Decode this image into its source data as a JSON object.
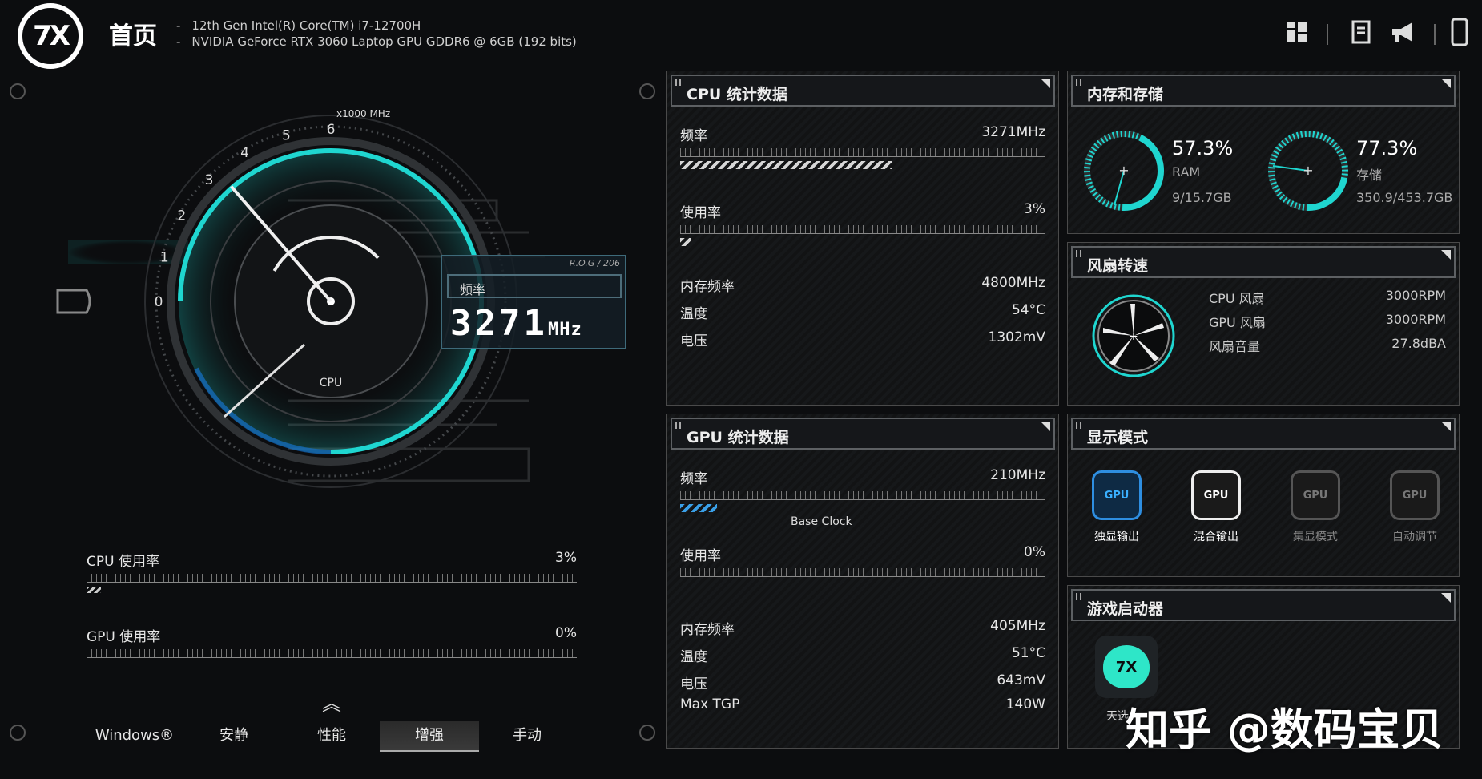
{
  "header": {
    "logo_text": "7X",
    "title": "首页",
    "cpu_info": "12th Gen Intel(R) Core(TM) i7-12700H",
    "gpu_info": "NVIDIA GeForce RTX 3060 Laptop GPU GDDR6 @ 6GB (192 bits)",
    "icons": [
      "layout-icon",
      "notes-icon",
      "announcement-icon",
      "phone-icon"
    ]
  },
  "gauge": {
    "scale_unit": "x1000 MHz",
    "ticks": [
      "0",
      "1",
      "2",
      "3",
      "4",
      "5",
      "6"
    ],
    "center_label": "CPU",
    "box_tag": "R.O.G / 206",
    "box_label": "频率",
    "box_value": "3271",
    "box_unit": "MHz",
    "level_ghz": 3.271
  },
  "usage": {
    "cpu": {
      "label": "CPU 使用率",
      "value": "3%",
      "level": 0.03
    },
    "gpu": {
      "label": "GPU 使用率",
      "value": "0%",
      "level": 0.0
    }
  },
  "modes": [
    {
      "label": "Windows®",
      "active": false
    },
    {
      "label": "安静",
      "active": false
    },
    {
      "label": "性能",
      "active": false
    },
    {
      "label": "增强",
      "active": true
    },
    {
      "label": "手动",
      "active": false
    }
  ],
  "cpu_panel": {
    "title": "CPU 统计数据",
    "freq_label": "频率",
    "freq_value": "3271MHz",
    "freq_level": 0.58,
    "usage_label": "使用率",
    "usage_value": "3%",
    "usage_level": 0.03,
    "mem_label": "内存频率",
    "mem_value": "4800MHz",
    "temp_label": "温度",
    "temp_value": "54°C",
    "volt_label": "电压",
    "volt_value": "1302mV"
  },
  "gpu_panel": {
    "title": "GPU 统计数据",
    "freq_label": "频率",
    "freq_value": "210MHz",
    "freq_level": 0.1,
    "base_clock_label": "Base Clock",
    "usage_label": "使用率",
    "usage_value": "0%",
    "mem_label": "内存频率",
    "mem_value": "405MHz",
    "temp_label": "温度",
    "temp_value": "51°C",
    "volt_label": "电压",
    "volt_value": "643mV",
    "tgp_label": "Max TGP",
    "tgp_value": "140W"
  },
  "memory_panel": {
    "title": "内存和存储",
    "ram": {
      "percent": "57.3%",
      "label": "RAM",
      "detail": "9/15.7GB",
      "level": 0.573
    },
    "storage": {
      "percent": "77.3%",
      "label": "存储",
      "detail": "350.9/453.7GB",
      "level": 0.773
    }
  },
  "fan_panel": {
    "title": "风扇转速",
    "cpu_fan_label": "CPU 风扇",
    "cpu_fan_value": "3000RPM",
    "gpu_fan_label": "GPU 风扇",
    "gpu_fan_value": "3000RPM",
    "noise_label": "风扇音量",
    "noise_value": "27.8dBA"
  },
  "display_panel": {
    "title": "显示模式",
    "modes": [
      {
        "label": "独显输出",
        "icon": "GPU"
      },
      {
        "label": "混合输出",
        "icon": "GPU"
      },
      {
        "label": "集显模式",
        "icon": "GPU"
      },
      {
        "label": "自动调节",
        "icon": "GPU"
      }
    ]
  },
  "game_panel": {
    "title": "游戏启动器",
    "app_label": "天选",
    "app_icon_text": "7X"
  },
  "watermark": "知乎 @数码宝贝",
  "colors": {
    "accent": "#1fd6d0",
    "panel_border": "#4a4a4a",
    "background": "#0c0d0f"
  }
}
